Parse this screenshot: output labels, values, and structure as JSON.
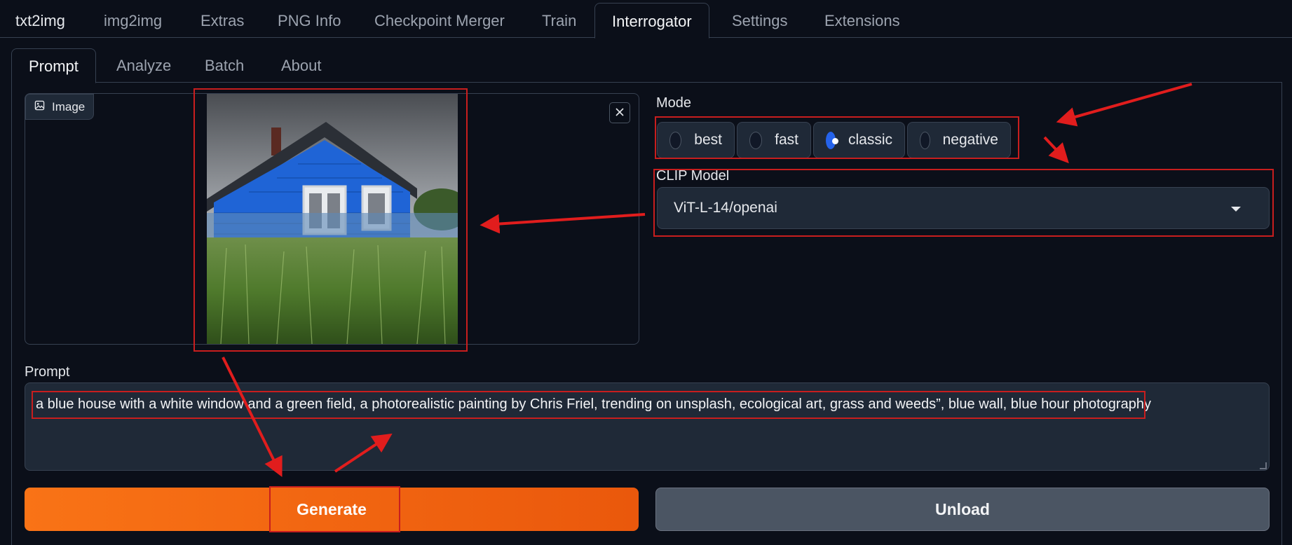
{
  "main_tabs": [
    "txt2img",
    "img2img",
    "Extras",
    "PNG Info",
    "Checkpoint Merger",
    "Train",
    "Interrogator",
    "Settings",
    "Extensions"
  ],
  "active_main_tab": "Interrogator",
  "sub_tabs": [
    "Prompt",
    "Analyze",
    "Batch",
    "About"
  ],
  "active_sub_tab": "Prompt",
  "image_input": {
    "label": "Image",
    "icon": "image-icon",
    "close_icon": "close-icon",
    "content": "blue house with white windows behind tall green grass, cloudy sky"
  },
  "mode": {
    "label": "Mode",
    "options": [
      "best",
      "fast",
      "classic",
      "negative"
    ],
    "selected": "classic"
  },
  "clip_model": {
    "label": "CLIP Model",
    "value": "ViT-L-14/openai"
  },
  "prompt": {
    "label": "Prompt",
    "value": "a blue house with a white window and a green field, a photorealistic painting by Chris Friel, trending on unsplash, ecological art, grass and weeds”, blue wall, blue hour photography"
  },
  "buttons": {
    "generate": "Generate",
    "unload": "Unload"
  },
  "colors": {
    "background": "#0b0f19",
    "generate_button": "#f97316",
    "unload_button": "#4b5563",
    "radio_selected": "#2563eb",
    "annotation": "#c81e1e"
  }
}
